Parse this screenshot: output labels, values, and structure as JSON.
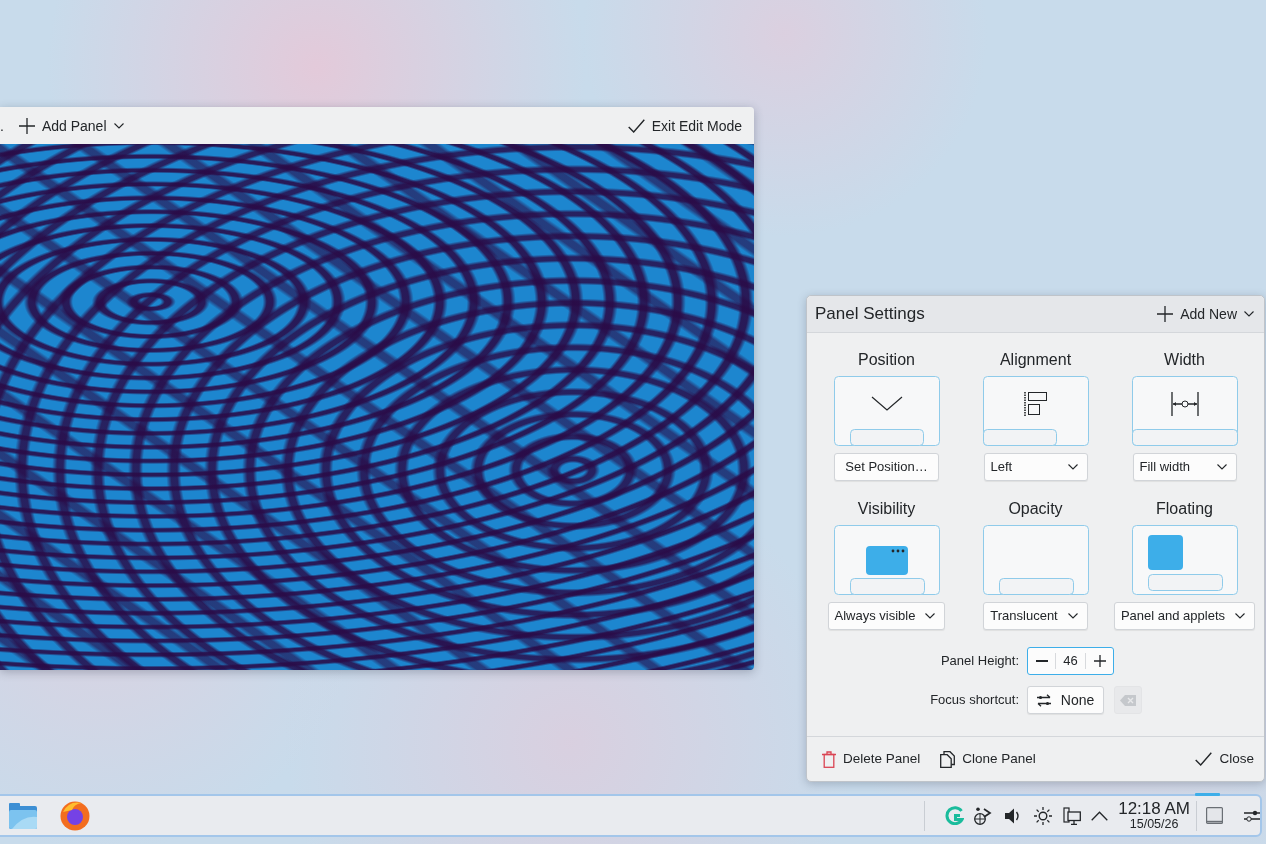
{
  "edit_toolbar": {
    "cut_text": ".",
    "add_panel": "Add Panel",
    "exit_edit_mode": "Exit Edit Mode"
  },
  "panel_settings": {
    "title": "Panel Settings",
    "add_new": "Add New",
    "options": [
      {
        "title": "Position",
        "preview": {
          "kind": "position"
        },
        "control": {
          "kind": "button",
          "value": "Set Position…"
        }
      },
      {
        "title": "Alignment",
        "preview": {
          "kind": "alignment"
        },
        "control": {
          "kind": "dropdown",
          "value": "Left"
        }
      },
      {
        "title": "Width",
        "preview": {
          "kind": "width"
        },
        "control": {
          "kind": "dropdown",
          "value": "Fill width"
        }
      },
      {
        "title": "Visibility",
        "preview": {
          "kind": "visibility"
        },
        "control": {
          "kind": "dropdown",
          "value": "Always visible"
        }
      },
      {
        "title": "Opacity",
        "preview": {
          "kind": "opacity"
        },
        "control": {
          "kind": "dropdown",
          "value": "Translucent"
        }
      },
      {
        "title": "Floating",
        "preview": {
          "kind": "floating"
        },
        "control": {
          "kind": "dropdown",
          "value": "Panel and applets"
        }
      }
    ],
    "panel_height": {
      "label": "Panel Height:",
      "value": "46"
    },
    "focus_shortcut": {
      "label": "Focus shortcut:",
      "value": "None",
      "clear_disabled": true
    },
    "footer": {
      "delete": "Delete Panel",
      "clone": "Clone Panel",
      "close": "Close"
    }
  },
  "taskbar": {
    "clock": {
      "time": "12:18 AM",
      "date": "15/05/26"
    }
  }
}
